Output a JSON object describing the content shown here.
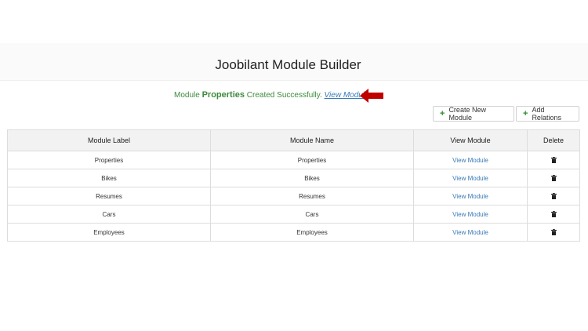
{
  "header": {
    "title": "Joobilant Module Builder"
  },
  "notice": {
    "prefix": "Module",
    "module": "Properties",
    "suffix": "Created Successfully.",
    "link": "View Module",
    "color": "#3c8a3c",
    "arrow_color": "#c00000"
  },
  "toolbar": {
    "create_label": "Create New Module",
    "relations_label": "Add Relations"
  },
  "table": {
    "headers": [
      "Module Label",
      "Module Name",
      "View Module",
      "Delete"
    ],
    "rows": [
      {
        "label": "Properties",
        "name": "Properties",
        "view": "View Module"
      },
      {
        "label": "Bikes",
        "name": "Bikes",
        "view": "View Module"
      },
      {
        "label": "Resumes",
        "name": "Resumes",
        "view": "View Module"
      },
      {
        "label": "Cars",
        "name": "Cars",
        "view": "View Module"
      },
      {
        "label": "Employees",
        "name": "Employees",
        "view": "View Module"
      }
    ]
  },
  "icons": {
    "delete": "trash-icon",
    "add": "plus-icon",
    "pointer": "arrow-left-icon"
  }
}
